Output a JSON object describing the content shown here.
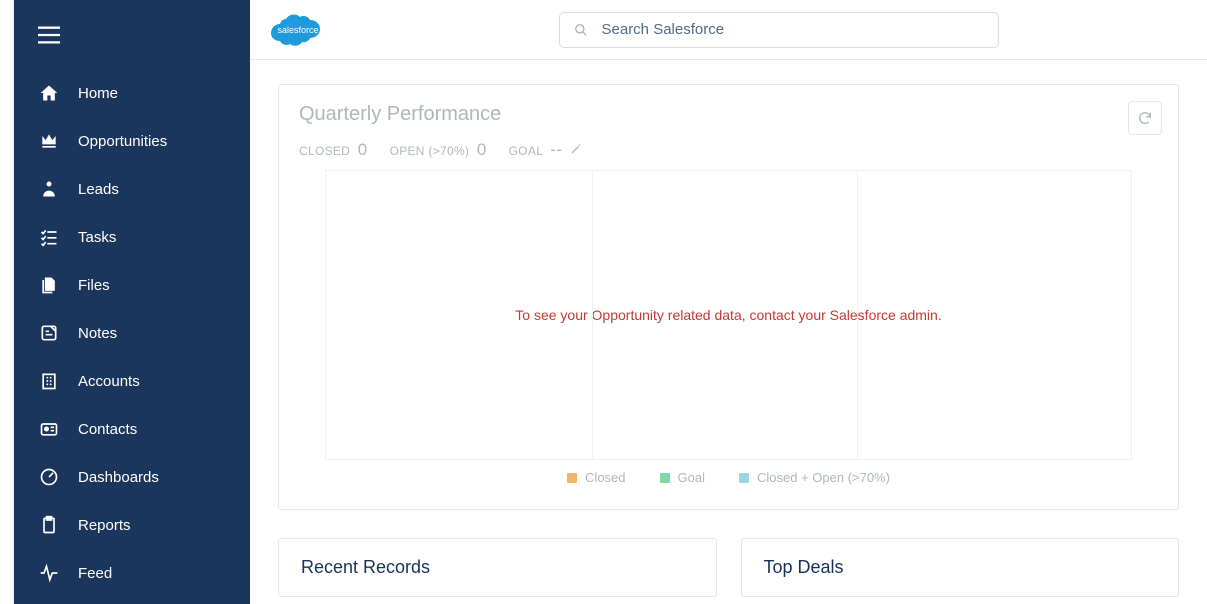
{
  "brand": {
    "name": "salesforce"
  },
  "search": {
    "placeholder": "Search Salesforce"
  },
  "sidebar": {
    "items": [
      {
        "label": "Home"
      },
      {
        "label": "Opportunities"
      },
      {
        "label": "Leads"
      },
      {
        "label": "Tasks"
      },
      {
        "label": "Files"
      },
      {
        "label": "Notes"
      },
      {
        "label": "Accounts"
      },
      {
        "label": "Contacts"
      },
      {
        "label": "Dashboards"
      },
      {
        "label": "Reports"
      },
      {
        "label": "Feed"
      }
    ]
  },
  "performance": {
    "title": "Quarterly Performance",
    "stats": {
      "closed_label": "CLOSED",
      "closed_value": "0",
      "open_label": "OPEN (>70%)",
      "open_value": "0",
      "goal_label": "GOAL",
      "goal_value": "--"
    },
    "message": "To see your Opportunity related data, contact your Salesforce admin.",
    "legend": {
      "closed": "Closed",
      "goal": "Goal",
      "closed_open": "Closed + Open (>70%)"
    }
  },
  "chart_data": {
    "type": "bar",
    "categories": [],
    "series": [
      {
        "name": "Closed",
        "values": [],
        "color": "#f5b26b"
      },
      {
        "name": "Goal",
        "values": [],
        "color": "#7fd8a3"
      },
      {
        "name": "Closed + Open (>70%)",
        "values": [],
        "color": "#9cd4e6"
      }
    ],
    "title": "Quarterly Performance",
    "note": "Chart is empty; placeholder message shown instead of data."
  },
  "colors": {
    "sidebar_bg": "#1b365d",
    "error_text": "#c23934",
    "muted_text": "#b0b6bf",
    "legend_closed": "#f5b26b",
    "legend_goal": "#7fd8a3",
    "legend_closed_open": "#9cd4e6",
    "logo_bg": "#1e9bdd"
  },
  "lower": {
    "recent_title": "Recent Records",
    "top_deals_title": "Top Deals"
  }
}
